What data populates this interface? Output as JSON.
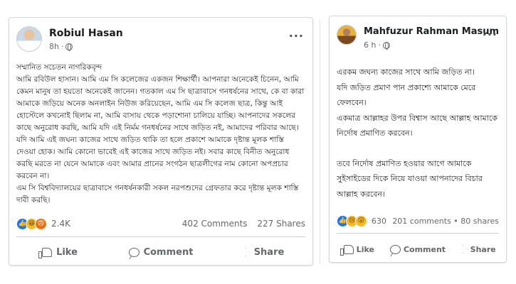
{
  "left_post": {
    "author": "Robiul Hasan",
    "time": "8h",
    "icons": {
      "avatar": "profile-photo",
      "privacy": "globe-icon",
      "more": "more-options-icon"
    },
    "more_label": "···",
    "paragraphs": [
      "সম্মানিত সচেতন নাগরিকবৃন্দ",
      "আমি রবিউল হাসান। আমি এম সি কলেজের একজন শিক্ষার্থী। আপনারা অনেকেই চিনেন, আমি কেমন মানুষ তা হয়তো অনেকেই জানেন। গতকাল এম সি ছাত্রাবাসে গনধর্ষনের সাথে, কে বা কারা আমাকে জড়িয়ে অনেক অনলাইন নিউজ করিয়েছেন, আমি এম সি কলেজ ছাত্র, কিন্তু আই হোস্টেলে কখনোই ছিলাম না, আমি বাসায় থেকে পড়াশোনা চালিয়ে যাচ্ছি। আপনাদের সকলের কাছে অনুরোধ করছি, আমি যদি এই নির্মম গনধর্ষনের সাথে জড়িত নই, আমাদের পরিবার আছে। যদি আমি এই জঘন্য কাজের সাথে জড়িত থাকি তা হলে প্রকাশে আমাকে দৃষ্টান্ত মূলক শাস্তি দেওয়া হোক। আমি কোনো ভাবেই এই কাজের সাথে জড়িত নই। সবার কাছে বিনীত অনুরোধ করছি মরতে না যেনে আমাকে এবং আমার প্রানের সংগঠন ছাত্রলীগের নাম কোনো অপপ্রচার করবেন না।",
      "এম সি বিশ্ববিদ্যালয়ের ছাত্রাবাসে গনধর্ষনকারী সকল নরপশুদের গ্রেফতার করে দৃষ্টান্ত মূলক শাস্তি দাবী করছি।"
    ],
    "reactions": {
      "icons": [
        "like-reaction-icon",
        "haha-reaction-icon",
        "angry-reaction-icon"
      ],
      "glyphs": [
        "👍",
        "😆",
        "😠"
      ],
      "count": "2.4K"
    },
    "comments_count": "402 Comments",
    "shares_count": "227 Shares",
    "actions": {
      "like": "Like",
      "comment": "Comment",
      "share": "Share"
    }
  },
  "right_post": {
    "author": "Mahfuzur Rahman Masum",
    "time": "6 h",
    "icons": {
      "avatar": "profile-photo",
      "privacy": "globe-icon",
      "more": "more-options-icon"
    },
    "more_label": "···",
    "paragraphs": [
      "এরকম জঘন্য কাজের সাথে আমি জড়িত না।",
      "যদি জড়িত প্রমাণ পান প্রকাশ্যে আমাকে মেরে ফেলবেন।",
      "একমাত্র আল্লাহর উপর বিশ্বাস আছে আল্লাহ আমাকে নির্দোষ প্রমাণিত করবেন।",
      "তবে নির্দোষ প্রমাণিত হওয়ার আগে আমাকে সুইসাইডের দিকে নিয়ে যাওয়া আপনাদের বিচার আল্লাহ করবেন।"
    ],
    "reactions": {
      "icons": [
        "like-reaction-icon",
        "sad-reaction-icon",
        "wow-reaction-icon"
      ],
      "glyphs": [
        "👍",
        "😢",
        "😮"
      ],
      "count": "630"
    },
    "stats_text": "201 comments • 80 shares",
    "actions": {
      "like": "Like",
      "comment": "Comment",
      "share": "Share"
    }
  },
  "colors": {
    "accent": "#1877f2",
    "secondary_text": "#65676b",
    "divider": "#ced0d4"
  }
}
